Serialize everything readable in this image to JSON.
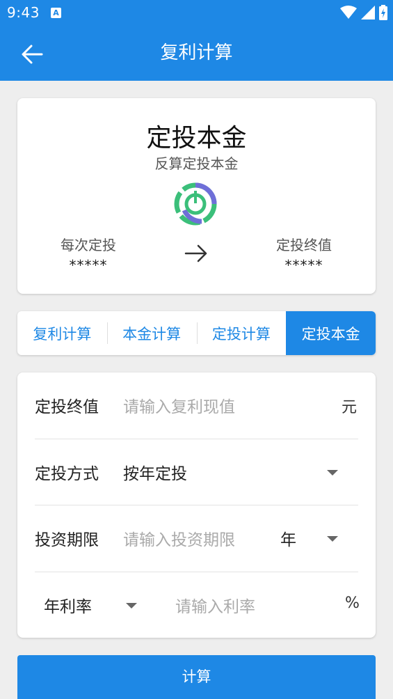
{
  "status_bar": {
    "time": "9:43",
    "notification_badge": "A"
  },
  "app_bar": {
    "title": "复利计算"
  },
  "hero": {
    "title": "定投本金",
    "subtitle": "反算定投本金",
    "left_label": "每次定投",
    "left_value": "*****",
    "right_label": "定投终值",
    "right_value": "*****"
  },
  "tabs": [
    {
      "label": "复利计算",
      "active": false
    },
    {
      "label": "本金计算",
      "active": false
    },
    {
      "label": "定投计算",
      "active": false
    },
    {
      "label": "定投本金",
      "active": true
    }
  ],
  "form": {
    "final_value": {
      "label": "定投终值",
      "placeholder": "请输入复利现值",
      "unit": "元"
    },
    "method": {
      "label": "定投方式",
      "value": "按年定投"
    },
    "period": {
      "label": "投资期限",
      "placeholder": "请输入投资期限",
      "unit": "年"
    },
    "rate": {
      "label": "年利率",
      "placeholder": "请输入利率",
      "unit": "%"
    }
  },
  "calculate_button": "计算",
  "colors": {
    "primary": "#1e88e5",
    "icon_green": "#3bbf7a",
    "icon_purple": "#6f6fd8"
  }
}
